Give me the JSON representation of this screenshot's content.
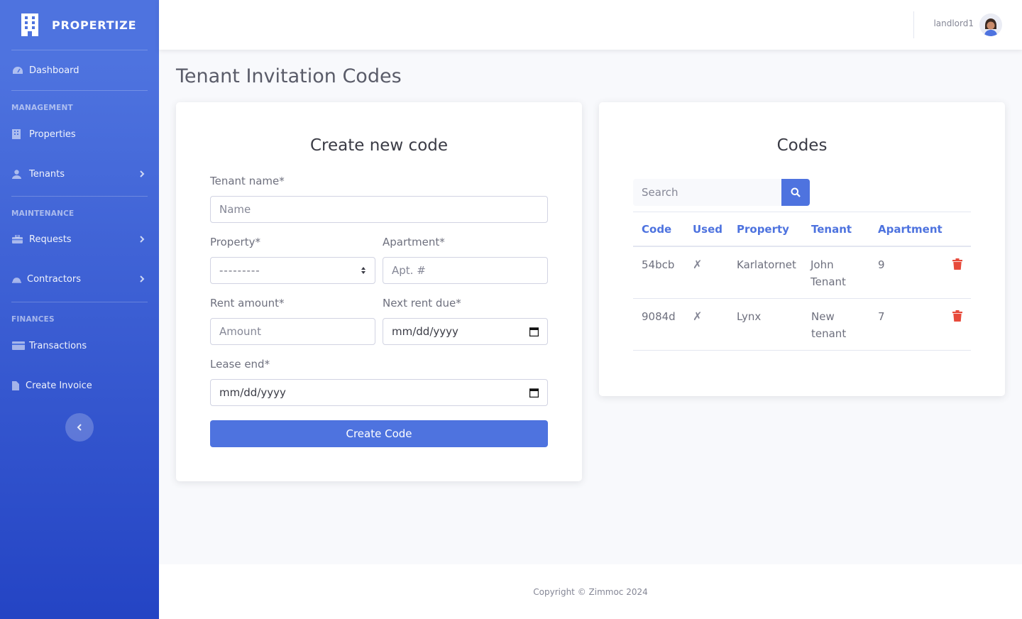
{
  "brand": {
    "name": "PROPERTIZE",
    "logo_icon": "building-icon"
  },
  "sidebar": {
    "dashboard": {
      "label": "Dashboard",
      "icon": "gauge-icon"
    },
    "headings": {
      "management": "MANAGEMENT",
      "maintenance": "MAINTENANCE",
      "finances": "FINANCES"
    },
    "items": {
      "properties": {
        "label": "Properties",
        "icon": "building-icon"
      },
      "tenants": {
        "label": "Tenants",
        "icon": "user-icon"
      },
      "requests": {
        "label": "Requests",
        "icon": "toolbox-icon"
      },
      "contractors": {
        "label": "Contractors",
        "icon": "hard-hat-icon"
      },
      "transactions": {
        "label": "Transactions",
        "icon": "credit-card-icon"
      },
      "create_invoice": {
        "label": "Create Invoice",
        "icon": "file-icon"
      }
    },
    "toggle_icon": "chevron-left-icon"
  },
  "topbar": {
    "username": "landlord1"
  },
  "page": {
    "title": "Tenant Invitation Codes"
  },
  "form": {
    "title": "Create new code",
    "tenant_name": {
      "label": "Tenant name*",
      "placeholder": "Name"
    },
    "property": {
      "label": "Property*",
      "selected": "---------"
    },
    "apartment": {
      "label": "Apartment*",
      "placeholder": "Apt. #"
    },
    "rent_amount": {
      "label": "Rent amount*",
      "placeholder": "Amount"
    },
    "next_rent_due": {
      "label": "Next rent due*",
      "value": "mm/dd/yyyy"
    },
    "lease_end": {
      "label": "Lease end*",
      "value": "mm/dd/yyyy"
    },
    "submit_label": "Create Code"
  },
  "codes": {
    "title": "Codes",
    "search_placeholder": "Search",
    "columns": [
      "Code",
      "Used",
      "Property",
      "Tenant",
      "Apartment"
    ],
    "rows": [
      {
        "code": "54bcb",
        "used": "✗",
        "property": "Karlatornet",
        "tenant": "John Tenant",
        "apartment": "9"
      },
      {
        "code": "9084d",
        "used": "✗",
        "property": "Lynx",
        "tenant": "New tenant",
        "apartment": "7"
      }
    ]
  },
  "footer": {
    "text": "Copyright © Zimmoc 2024"
  },
  "colors": {
    "primary": "#4e73df",
    "danger": "#e74a3b"
  }
}
